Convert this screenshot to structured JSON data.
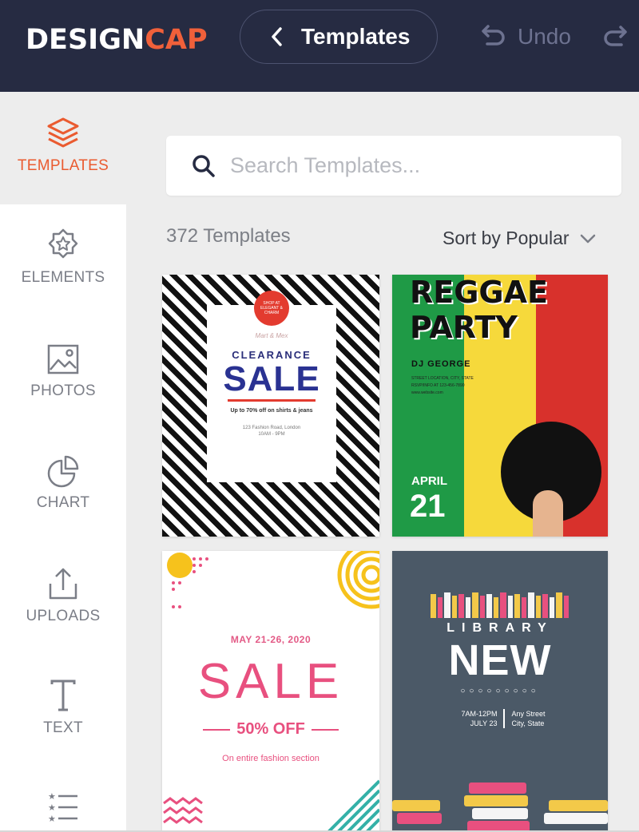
{
  "header": {
    "logo_main": "DESIGN",
    "logo_accent": "CAP",
    "back_label": "Templates",
    "undo_label": "Undo"
  },
  "sidebar": {
    "items": [
      {
        "label": "TEMPLATES",
        "icon": "layers-icon",
        "active": true
      },
      {
        "label": "ELEMENTS",
        "icon": "star-badge-icon"
      },
      {
        "label": "PHOTOS",
        "icon": "image-icon"
      },
      {
        "label": "CHART",
        "icon": "pie-chart-icon"
      },
      {
        "label": "UPLOADS",
        "icon": "upload-icon"
      },
      {
        "label": "TEXT",
        "icon": "text-icon"
      },
      {
        "label": "",
        "icon": "list-icon"
      }
    ]
  },
  "search": {
    "placeholder": "Search Templates..."
  },
  "results": {
    "count_label": "372 Templates",
    "sort_label": "Sort by Popular"
  },
  "templates": [
    {
      "circle_text": "SHOP AT ELEGANT & CHARM",
      "small_text": "Mart & Mex",
      "heading": "CLEARANCE",
      "title": "SALE",
      "subline": "Up to 70% off on shirts & jeans",
      "address": "123 Fashion Road, London\n10AM - 9PM"
    },
    {
      "title_line1": "REGGAE",
      "title_line2": "PARTY",
      "dj": "DJ GEORGE",
      "address_lines": "STREET LOCATION, CITY, STATE\nRSVP/INFO AT 123-456-7890\nwww.website.com",
      "month": "APRIL",
      "day": "21"
    },
    {
      "date": "MAY 21-26, 2020",
      "title": "SALE",
      "offer": "50% OFF",
      "note": "On entire fashion section"
    },
    {
      "heading": "LIBRARY",
      "title": "NEW",
      "dots": "○○○○○○○○○",
      "time": "7AM-12PM",
      "date": "JULY 23",
      "street": "Any Street",
      "city": "City, State"
    }
  ],
  "colors": {
    "header_bg": "#262b42",
    "accent": "#ea5b30",
    "sidebar_bg": "#ffffff",
    "content_bg": "#ededed"
  }
}
